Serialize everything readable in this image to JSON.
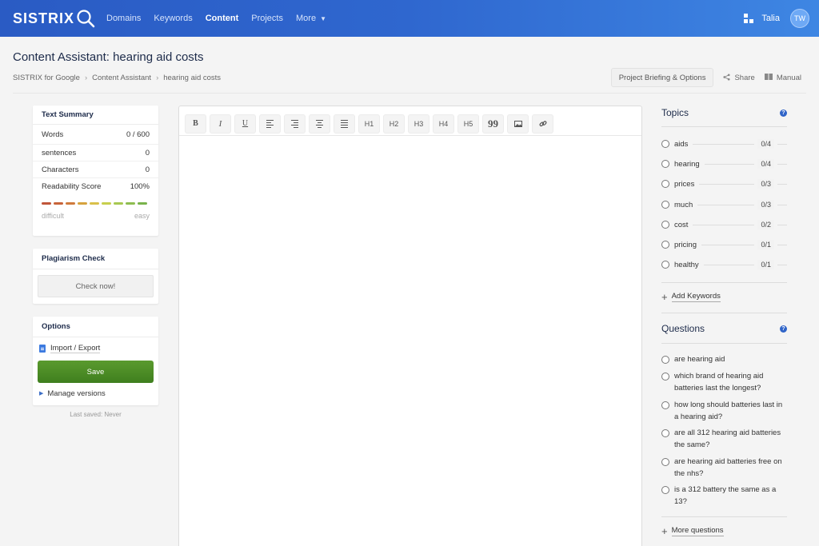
{
  "nav": {
    "logo": "SISTRIX",
    "items": [
      {
        "label": "Domains",
        "active": false
      },
      {
        "label": "Keywords",
        "active": false
      },
      {
        "label": "Content",
        "active": true
      },
      {
        "label": "Projects",
        "active": false
      },
      {
        "label": "More",
        "active": false
      }
    ],
    "user_name": "Talia",
    "avatar_initials": "TW"
  },
  "header": {
    "title": "Content Assistant: hearing aid costs",
    "breadcrumb": [
      "SISTRIX for Google",
      "Content Assistant",
      "hearing aid costs"
    ],
    "briefing_button": "Project Briefing & Options",
    "share_label": "Share",
    "manual_label": "Manual"
  },
  "summary": {
    "title": "Text Summary",
    "rows": [
      {
        "label": "Words",
        "value": "0 / 600"
      },
      {
        "label": "sentences",
        "value": "0"
      },
      {
        "label": "Characters",
        "value": "0"
      },
      {
        "label": "Readability Score",
        "value": "100%"
      }
    ],
    "scale_low": "difficult",
    "scale_high": "easy",
    "bar_colors": [
      "#c0563a",
      "#c8643a",
      "#cf7a3c",
      "#d6a33e",
      "#d9c04a",
      "#c7cf4e",
      "#a8c852",
      "#8ebd50",
      "#79b34c"
    ]
  },
  "plagiarism": {
    "title": "Plagiarism Check",
    "button": "Check now!"
  },
  "options": {
    "title": "Options",
    "import_export": "Import / Export",
    "save": "Save",
    "manage_versions": "Manage versions",
    "last_saved": "Last saved: Never"
  },
  "toolbar": {
    "bold": "B",
    "italic": "I",
    "underline": "U",
    "h1": "H1",
    "h2": "H2",
    "h3": "H3",
    "h4": "H4",
    "h5": "H5",
    "quote": "99"
  },
  "topics": {
    "title": "Topics",
    "items": [
      {
        "label": "aids",
        "count": "0/4"
      },
      {
        "label": "hearing",
        "count": "0/4"
      },
      {
        "label": "prices",
        "count": "0/3"
      },
      {
        "label": "much",
        "count": "0/3"
      },
      {
        "label": "cost",
        "count": "0/2"
      },
      {
        "label": "pricing",
        "count": "0/1"
      },
      {
        "label": "healthy",
        "count": "0/1"
      }
    ],
    "add_keywords": "Add Keywords"
  },
  "questions": {
    "title": "Questions",
    "items": [
      "are hearing aid",
      "which brand of hearing aid batteries last the longest?",
      "how long should batteries last in a hearing aid?",
      "are all 312 hearing aid batteries the same?",
      "are hearing aid batteries free on the nhs?",
      "is a 312 battery the same as a 13?"
    ],
    "more_questions": "More questions"
  },
  "colors": {
    "nav_start": "#2a5bc4",
    "nav_end": "#3e86e3",
    "save_green": "#4c8c25",
    "help_blue": "#2f64c8"
  }
}
